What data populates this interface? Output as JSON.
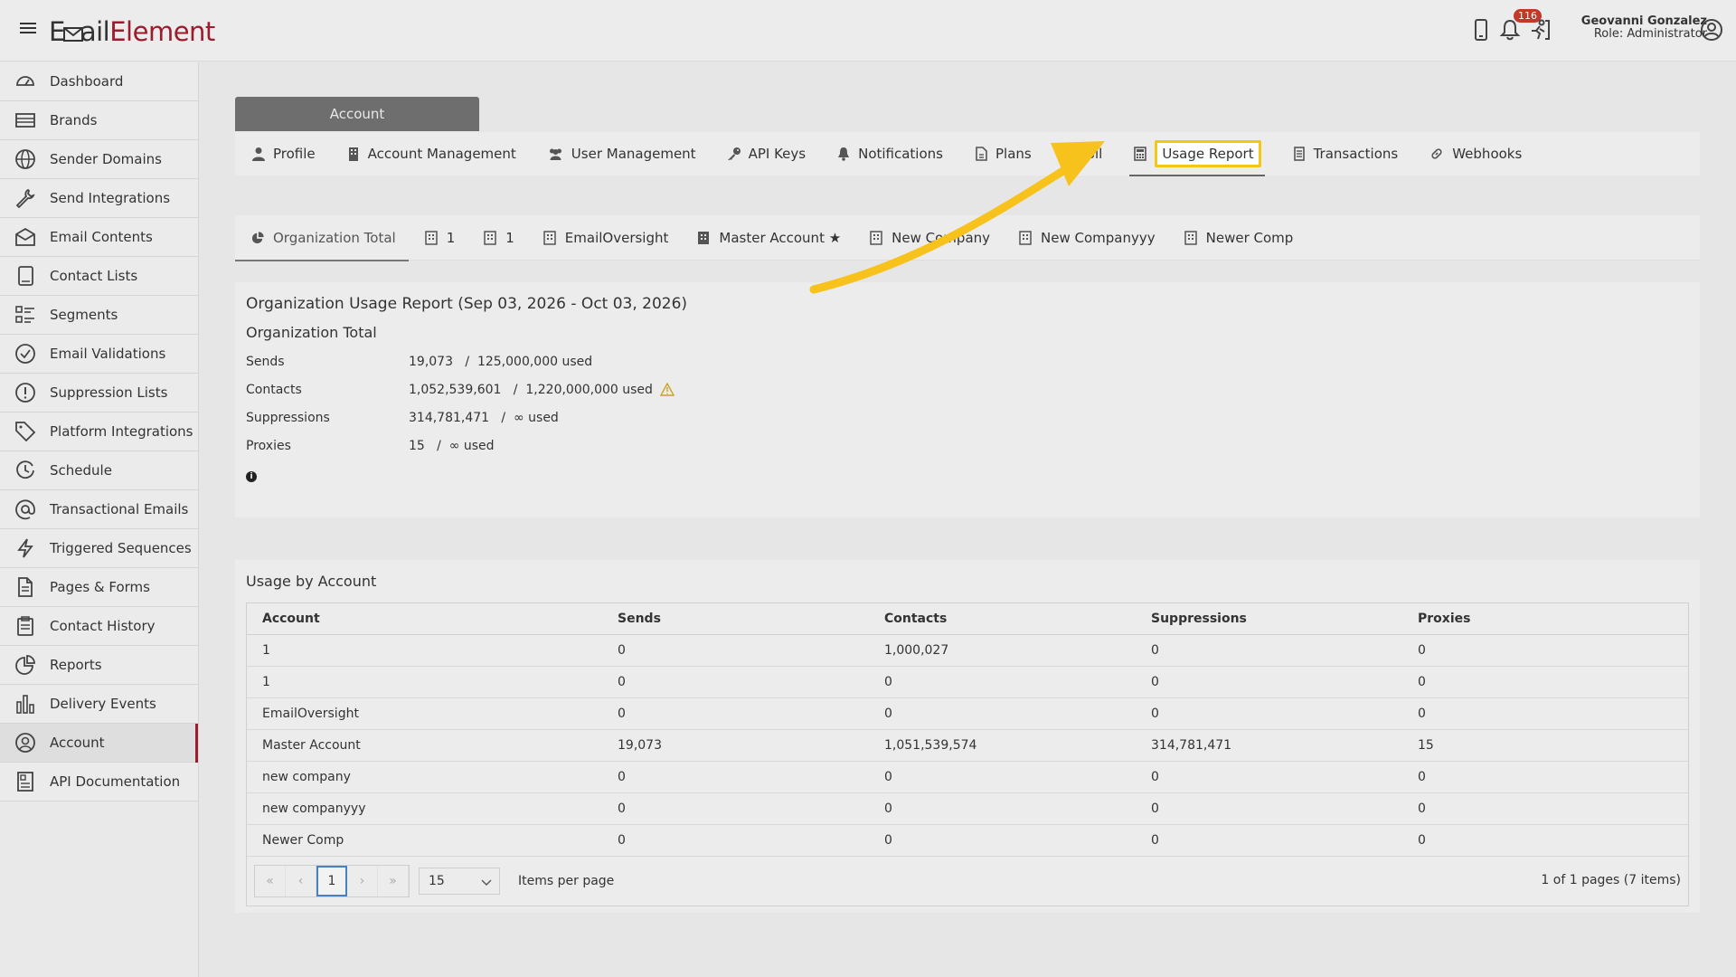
{
  "header": {
    "logo_part1": "E",
    "logo_part2": "ail",
    "logo_part3": "Element",
    "notification_count": "116",
    "user_name": "Geovanni Gonzalez",
    "user_role": "Role: Administrator"
  },
  "sidebar": {
    "items": [
      {
        "label": "Dashboard",
        "icon": "dashboard-icon"
      },
      {
        "label": "Brands",
        "icon": "brands-icon"
      },
      {
        "label": "Sender Domains",
        "icon": "globe-icon"
      },
      {
        "label": "Send Integrations",
        "icon": "wrench-icon"
      },
      {
        "label": "Email Contents",
        "icon": "envelope-icon"
      },
      {
        "label": "Contact Lists",
        "icon": "book-icon"
      },
      {
        "label": "Segments",
        "icon": "segments-icon"
      },
      {
        "label": "Email Validations",
        "icon": "check-circle-icon"
      },
      {
        "label": "Suppression Lists",
        "icon": "exclamation-circle-icon"
      },
      {
        "label": "Platform Integrations",
        "icon": "tag-icon"
      },
      {
        "label": "Schedule",
        "icon": "clock-icon"
      },
      {
        "label": "Transactional Emails",
        "icon": "at-icon"
      },
      {
        "label": "Triggered Sequences",
        "icon": "bolt-icon"
      },
      {
        "label": "Pages & Forms",
        "icon": "file-icon"
      },
      {
        "label": "Contact History",
        "icon": "clipboard-icon"
      },
      {
        "label": "Reports",
        "icon": "pie-chart-icon"
      },
      {
        "label": "Delivery Events",
        "icon": "bar-chart-icon"
      },
      {
        "label": "Account",
        "icon": "user-circle-icon"
      },
      {
        "label": "API Documentation",
        "icon": "document-icon"
      }
    ]
  },
  "account_tab": "Account",
  "tabs": [
    {
      "label": "Profile",
      "icon": "user-icon"
    },
    {
      "label": "Account Management",
      "icon": "building-icon"
    },
    {
      "label": "User Management",
      "icon": "users-icon"
    },
    {
      "label": "API Keys",
      "icon": "key-icon"
    },
    {
      "label": "Notifications",
      "icon": "bell-icon"
    },
    {
      "label": "Plans",
      "icon": "file-icon"
    },
    {
      "label": "Bil",
      "icon": "credit-card-icon"
    },
    {
      "label": "Usage Report",
      "icon": "calculator-icon"
    },
    {
      "label": "Transactions",
      "icon": "receipt-icon"
    },
    {
      "label": "Webhooks",
      "icon": "link-icon"
    }
  ],
  "subtabs": [
    {
      "label": "Organization Total",
      "icon": "pie-icon"
    },
    {
      "label": "1",
      "icon": "building-icon"
    },
    {
      "label": "1",
      "icon": "building-icon"
    },
    {
      "label": "EmailOversight",
      "icon": "building-icon"
    },
    {
      "label": "Master Account ★",
      "icon": "building-icon"
    },
    {
      "label": "New Company",
      "icon": "building-icon"
    },
    {
      "label": "New Companyyy",
      "icon": "building-icon"
    },
    {
      "label": "Newer Comp",
      "icon": "building-icon"
    }
  ],
  "report": {
    "title": "Organization Usage Report (Sep 03, 2026 - Oct 03, 2026)",
    "subtitle": "Organization Total",
    "rows": [
      {
        "label": "Sends",
        "value": "19,073   /  125,000,000 used"
      },
      {
        "label": "Contacts",
        "value": "1,052,539,601   /  1,220,000,000 used"
      },
      {
        "label": "Suppressions",
        "value": "314,781,471   /  ∞ used"
      },
      {
        "label": "Proxies",
        "value": "15   /  ∞ used"
      }
    ],
    "info_icon": "i"
  },
  "usage": {
    "title": "Usage by Account",
    "columns": [
      "Account",
      "Sends",
      "Contacts",
      "Suppressions",
      "Proxies"
    ],
    "rows": [
      [
        "1",
        "0",
        "1,000,027",
        "0",
        "0"
      ],
      [
        "1",
        "0",
        "0",
        "0",
        "0"
      ],
      [
        "EmailOversight",
        "0",
        "0",
        "0",
        "0"
      ],
      [
        "Master Account",
        "19,073",
        "1,051,539,574",
        "314,781,471",
        "15"
      ],
      [
        "new company",
        "0",
        "0",
        "0",
        "0"
      ],
      [
        "new companyyy",
        "0",
        "0",
        "0",
        "0"
      ],
      [
        "Newer Comp",
        "0",
        "0",
        "0",
        "0"
      ]
    ]
  },
  "pager": {
    "first": "«",
    "prev": "‹",
    "current": "1",
    "next": "›",
    "last": "»",
    "per_page": "15",
    "per_page_label": "Items per page",
    "info": "1 of 1 pages (7 items)"
  },
  "colors": {
    "brand": "#9b1c2c",
    "highlight": "#f5c518",
    "arrow": "#f7c21b"
  }
}
